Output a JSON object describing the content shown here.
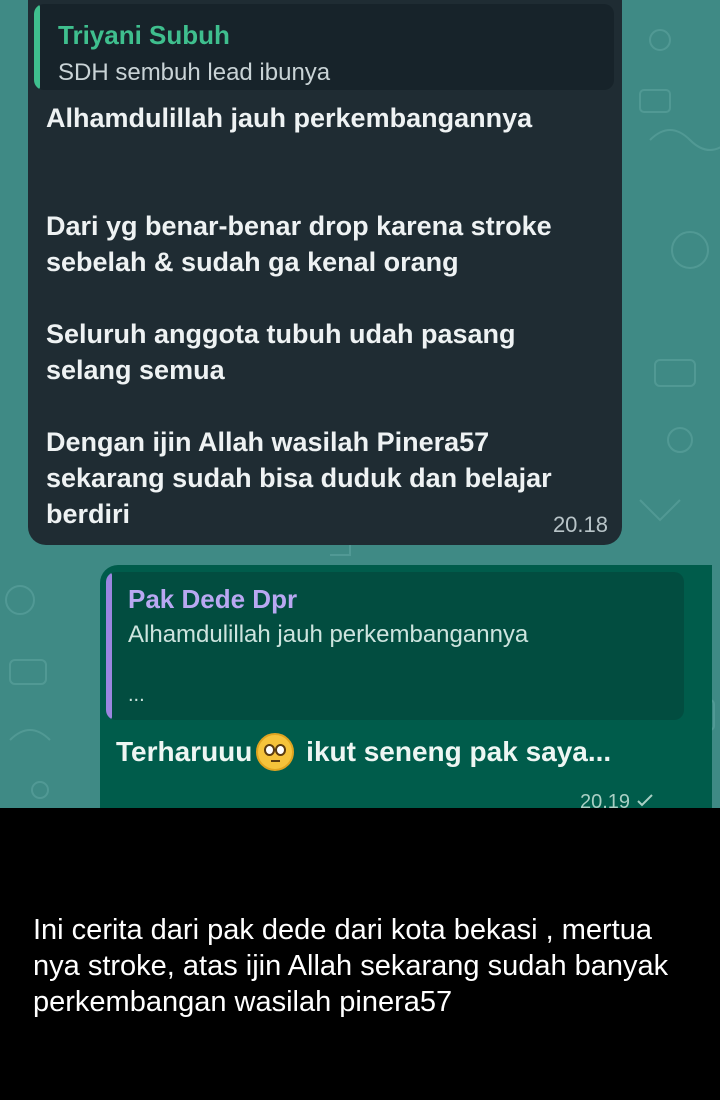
{
  "chat": {
    "incoming": {
      "quote_author": "Triyani Subuh",
      "quote_text": "SDH sembuh lead ibunya",
      "message": "Alhamdulillah jauh perkembangannya\n\n\nDari yg benar-benar drop karena stroke\nsebelah & sudah ga kenal orang\n\nSeluruh anggota tubuh udah pasang\nselang semua\n\nDengan ijin Allah wasilah Pinera57\nsekarang sudah bisa duduk dan belajar\nberdiri",
      "time": "20.18"
    },
    "outgoing": {
      "quote_author": "Pak Dede Dpr",
      "quote_text": "Alhamdulillah jauh perkembangannya",
      "quote_ellipsis": "...",
      "message_before": "Terharuuu",
      "emoji_icon": "flushed-face-emoji",
      "message_after": " ikut seneng pak saya...",
      "time": "20.19",
      "status_icon": "check-icon"
    }
  },
  "caption": "Ini cerita dari pak dede dari kota bekasi , mertua nya stroke, atas ijin Allah sekarang sudah banyak perkembangan wasilah pinera57",
  "colors": {
    "chat_background": "#3f8a85",
    "incoming_bubble": "#1f2c33",
    "outgoing_bubble": "#005c4b",
    "incoming_quote_accent": "#3fbf8e",
    "outgoing_quote_accent": "#9b86e0"
  }
}
